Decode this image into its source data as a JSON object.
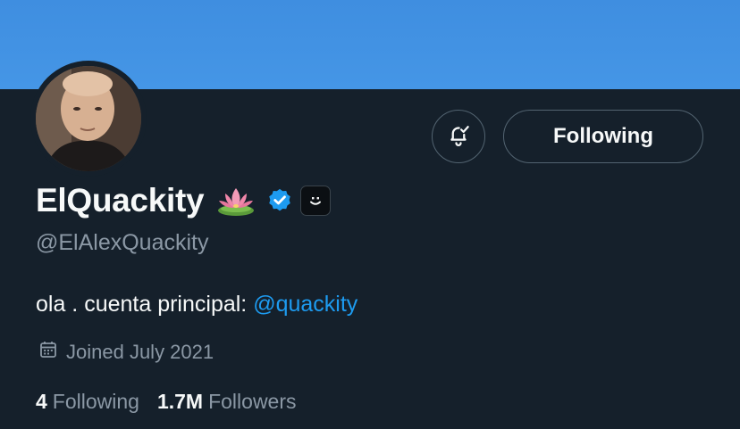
{
  "profile": {
    "display_name": "ElQuackity",
    "handle": "@ElAlexQuackity",
    "bio_text": "ola . cuenta principal: ",
    "bio_mention": "@quackity",
    "joined": "Joined July 2021",
    "emoji_badge": "lotus-icon",
    "verified": true,
    "affiliate_badge": "smiley-face-icon"
  },
  "actions": {
    "notify_icon": "bell-check-icon",
    "following_label": "Following"
  },
  "stats": {
    "following_count": "4",
    "following_label": "Following",
    "followers_count": "1.7M",
    "followers_label": "Followers"
  },
  "colors": {
    "background": "#15202b",
    "banner": "#4596e6",
    "accent": "#1d9bf0",
    "secondary_text": "#8b98a5",
    "border": "#536471"
  }
}
